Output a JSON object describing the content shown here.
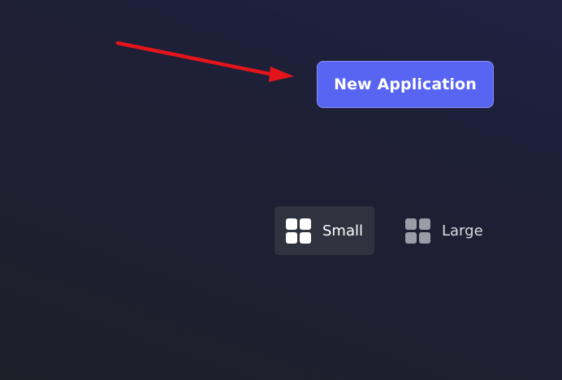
{
  "colors": {
    "accent": "#5865f2",
    "annotation_arrow": "#e3151a",
    "icon_active": "#ffffff",
    "icon_inactive": "#9c9ca8",
    "label_active": "#ffffff",
    "label_inactive": "#dcdde1"
  },
  "header": {
    "new_application_label": "New Application"
  },
  "size_toggle": {
    "options": [
      {
        "label": "Small",
        "icon": "grid-icon",
        "selected": true
      },
      {
        "label": "Large",
        "icon": "grid-icon",
        "selected": false
      }
    ]
  },
  "annotation": {
    "icon": "arrow-icon"
  }
}
